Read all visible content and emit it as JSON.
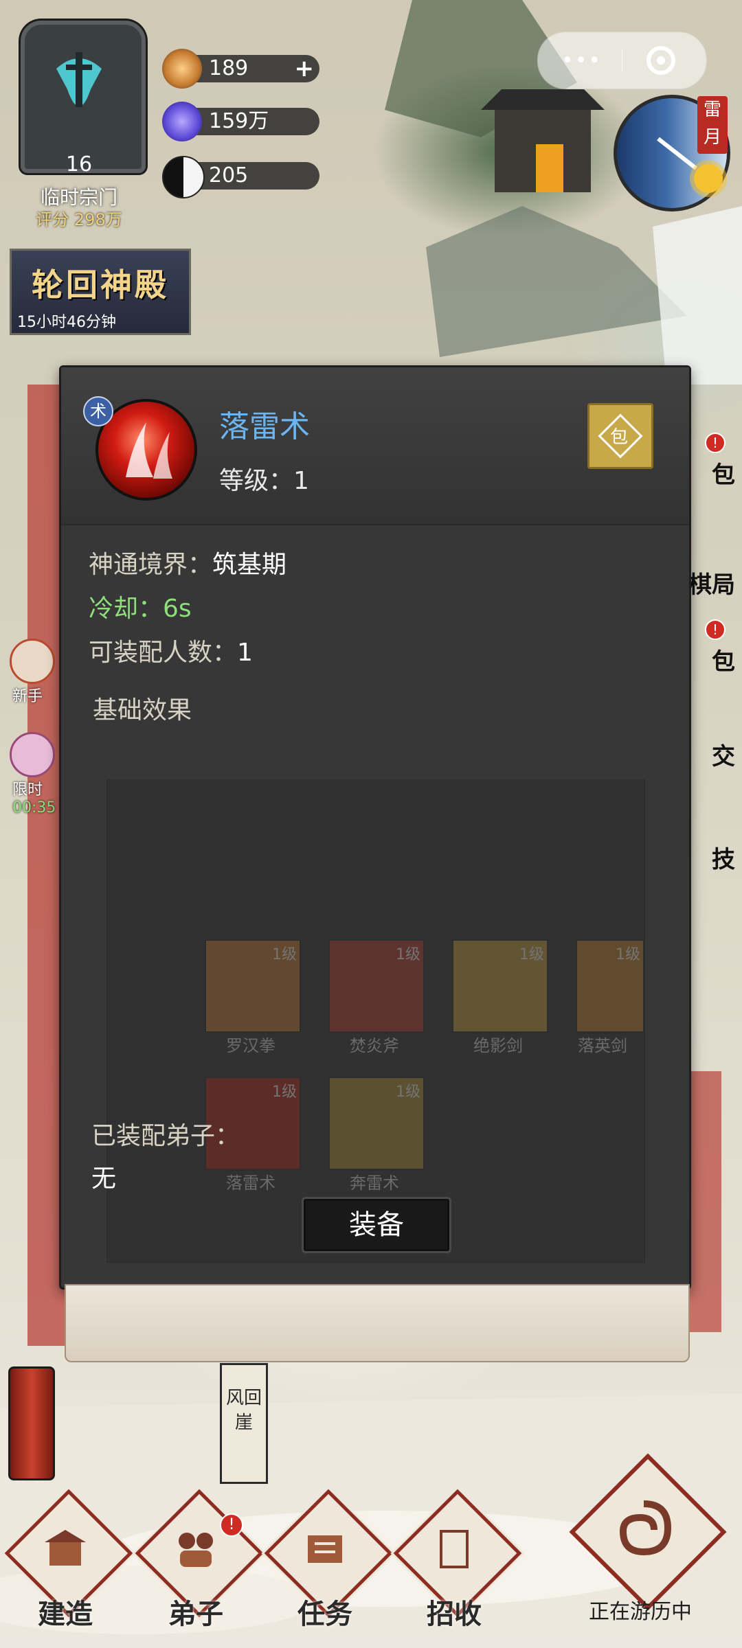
{
  "sect": {
    "level": "16",
    "name": "临时宗门",
    "score": "评分 298万"
  },
  "resources": [
    {
      "icon": "spirit-stone-icon",
      "value": "189",
      "has_plus": true
    },
    {
      "icon": "crystal-icon",
      "value": "159万",
      "has_plus": false
    },
    {
      "icon": "taiji-icon",
      "value": "205",
      "has_plus": false
    }
  ],
  "clock": {
    "tag": "雷月"
  },
  "banner": {
    "title": "轮回神殿",
    "timer": "15小时46分钟"
  },
  "skill": {
    "type_badge": "术",
    "name": "落雷术",
    "level_text": "等级：1",
    "realm_label": "神通境界：",
    "realm_value": "筑基期",
    "cooldown_label": "冷却：",
    "cooldown_value": "6s",
    "slots_label": "可装配人数：",
    "slots_value": "1",
    "base_effect": "基础效果",
    "equipped_label": "已装配弟子：",
    "equipped_value": "无",
    "equip_button": "装备"
  },
  "background_skills": [
    {
      "name": "罗汉拳",
      "level": "1级",
      "color": "#c77a2a"
    },
    {
      "name": "焚炎斧",
      "level": "1级",
      "color": "#b8392a"
    },
    {
      "name": "绝影剑",
      "level": "1级",
      "color": "#c9a23a"
    },
    {
      "name": "落英剑",
      "level": "1级",
      "color": "#c7842b"
    },
    {
      "name": "落雷术",
      "level": "1级",
      "color": "#b42418"
    },
    {
      "name": "奔雷术",
      "level": "1级",
      "color": "#b3922f"
    }
  ],
  "side_buttons": [
    {
      "label": "包",
      "badge": "!"
    },
    {
      "label": "棋局",
      "badge": ""
    },
    {
      "label": "包",
      "badge": "!"
    },
    {
      "label": "交",
      "badge": ""
    },
    {
      "label": "技",
      "badge": ""
    }
  ],
  "left_side": [
    {
      "label": "新手"
    },
    {
      "label": "限时",
      "timer": "00:35"
    }
  ],
  "location": "风回崖",
  "bottom_nav": [
    {
      "label": "建造",
      "badge": ""
    },
    {
      "label": "弟子",
      "badge": "!"
    },
    {
      "label": "任务",
      "badge": ""
    },
    {
      "label": "招收",
      "badge": ""
    }
  ],
  "travel": {
    "label": "正在游历中"
  },
  "colors": {
    "skill_name": "#6bb6f2",
    "cooldown": "#8ee07a",
    "badge_red": "#d02b22",
    "nav_frame": "#8d2d22"
  }
}
